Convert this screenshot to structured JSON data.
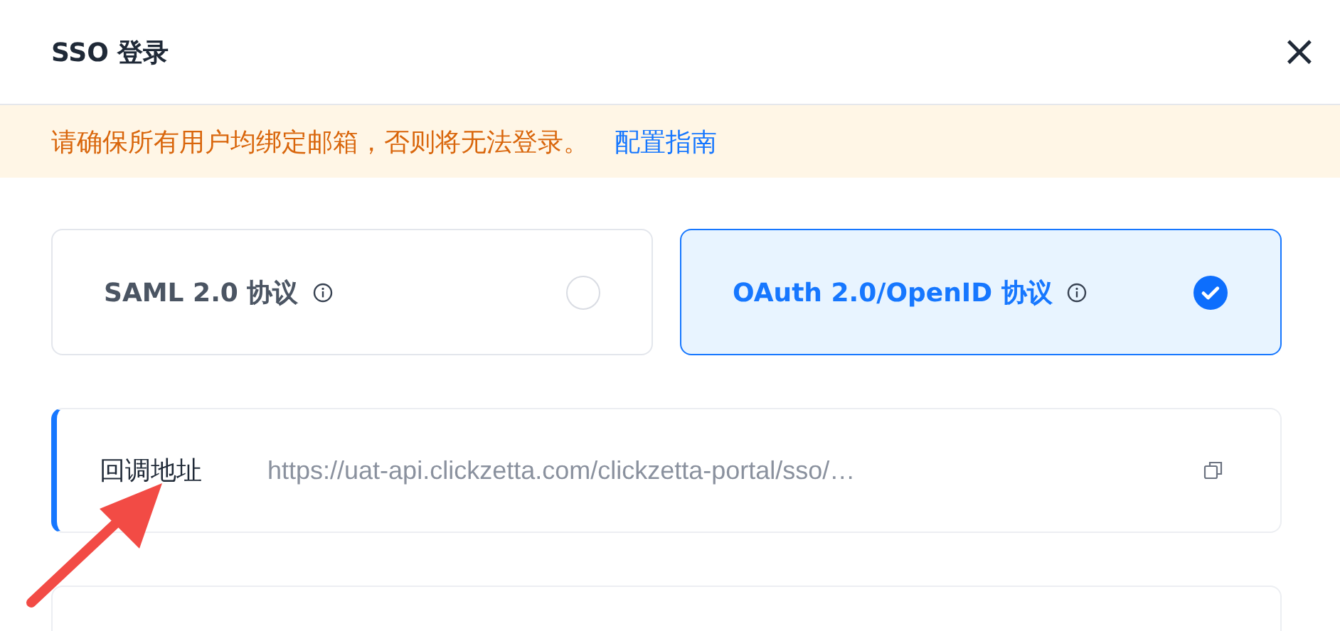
{
  "dialog": {
    "title": "SSO 登录",
    "close": "×"
  },
  "notice": {
    "text": "请确保所有用户均绑定邮箱，否则将无法登录。",
    "link": "配置指南"
  },
  "protocols": [
    {
      "label": "SAML 2.0 协议",
      "selected": false
    },
    {
      "label": "OAuth 2.0/OpenID 协议",
      "selected": true
    }
  ],
  "fields": [
    {
      "label": "回调地址",
      "value": "https://uat-api.clickzetta.com/clickzetta-portal/sso/…",
      "highlighted": true
    }
  ]
}
